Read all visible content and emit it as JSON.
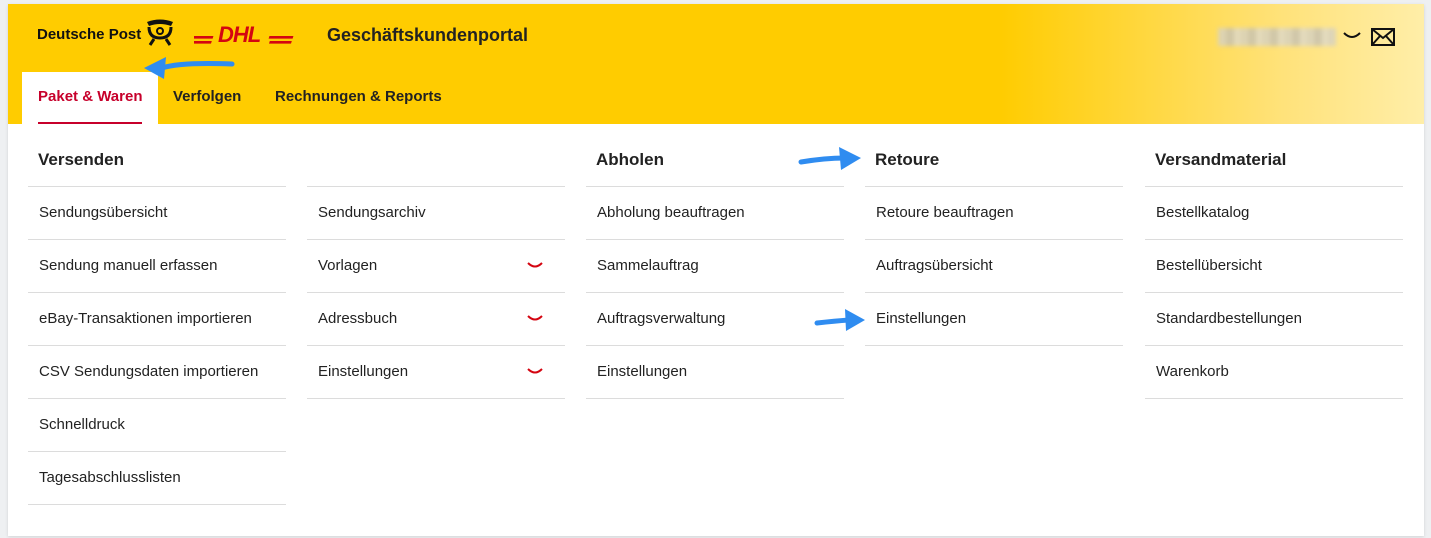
{
  "header": {
    "brand": "Deutsche Post",
    "title": "Geschäftskundenportal",
    "accent_color": "#ffcc00",
    "brand_red": "#d40511"
  },
  "tabs": [
    {
      "label": "Paket & Waren",
      "active": true
    },
    {
      "label": "Verfolgen"
    },
    {
      "label": "Rechnungen & Reports"
    }
  ],
  "menu": {
    "versenden": {
      "title": "Versenden",
      "items": [
        "Sendungsübersicht",
        "Sendung manuell erfassen",
        "eBay-Transaktionen importieren",
        "CSV Sendungsdaten importieren",
        "Schnelldruck",
        "Tagesabschlusslisten"
      ]
    },
    "versenden2": {
      "items": [
        "Sendungsarchiv",
        "Vorlagen",
        "Adressbuch",
        "Einstellungen"
      ]
    },
    "abholen": {
      "title": "Abholen",
      "items": [
        "Abholung beauftragen",
        "Sammelauftrag",
        "Auftragsverwaltung",
        "Einstellungen"
      ]
    },
    "retoure": {
      "title": "Retoure",
      "items": [
        "Retoure beauftragen",
        "Auftragsübersicht",
        "Einstellungen"
      ]
    },
    "versandmaterial": {
      "title": "Versandmaterial",
      "items": [
        "Bestellkatalog",
        "Bestellübersicht",
        "Standardbestellungen",
        "Warenkorb"
      ]
    }
  },
  "icons": {
    "posthorn": "deutsche-post-horn-icon",
    "dhl": "dhl-logo",
    "chevron": "chevron-down-icon",
    "mail": "mail-icon",
    "annotation_arrow": "blue-arrow-annotation"
  }
}
